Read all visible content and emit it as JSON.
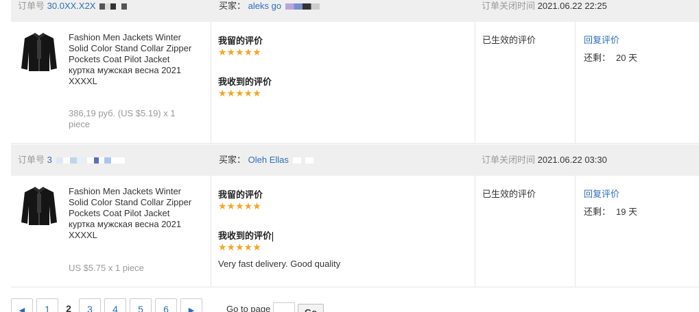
{
  "orders": [
    {
      "order_label": "订单号",
      "order_no": "30.0XX.X2X",
      "buyer_label": "买家：",
      "buyer_name": "aleks go",
      "close_label": "订单关闭时间",
      "close_time": "2021.06.22 22:25",
      "product_title": "Fashion Men Jackets Winter Solid Color Stand Collar Zipper Pockets Coat Pilot Jacket куртка мужская весна 2021 XXXXL",
      "product_price": "386,19 руб. (US $5.19) x 1 piece",
      "my_review_label": "我留的评价",
      "my_review_stars": "★★★★★",
      "received_review_label": "我收到的评价",
      "received_review_stars": "★★★★★",
      "received_review_text": "",
      "status": "已生效的评价",
      "reply_label": "回复评价",
      "remaining_label": "还剩：",
      "remaining_value": "20 天"
    },
    {
      "order_label": "订单号",
      "order_no": "3",
      "buyer_label": "买家：",
      "buyer_name": "Oleh Ellas",
      "close_label": "订单关闭时间",
      "close_time": "2021.06.22 03:30",
      "product_title": "Fashion Men Jackets Winter Solid Color Stand Collar Zipper Pockets Coat Pilot Jacket куртка мужская весна 2021 XXXXL",
      "product_price": "US $5.75 x 1 piece",
      "my_review_label": "我留的评价",
      "my_review_stars": "★★★★★",
      "received_review_label": "我收到的评价",
      "received_review_stars": "★★★★★",
      "received_review_text": "Very fast delivery. Good quality",
      "status": "已生效的评价",
      "reply_label": "回复评价",
      "remaining_label": "还剩：",
      "remaining_value": "19 天"
    }
  ],
  "pagination": {
    "prev_icon": "◀",
    "pages": [
      "1",
      "2",
      "3",
      "4",
      "5",
      "6"
    ],
    "current_page": "2",
    "next_icon": "▶",
    "goto_label": "Go to page",
    "goto_value": "",
    "go_button": "Go"
  },
  "colors": {
    "accent_link": "#2a6ebb",
    "star": "#f5a623",
    "header_bg": "#efefef"
  }
}
